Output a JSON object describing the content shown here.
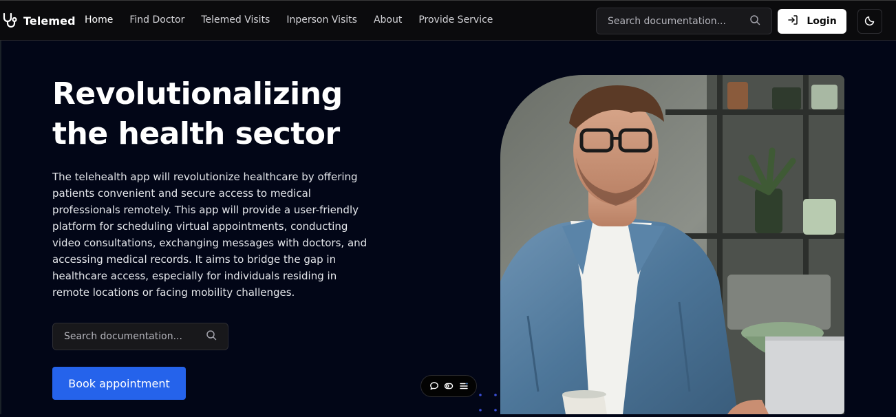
{
  "brand": {
    "name": "Telemed",
    "logo_icon": "stethoscope-icon"
  },
  "nav": {
    "items": [
      {
        "label": "Home",
        "active": true
      },
      {
        "label": "Find Doctor"
      },
      {
        "label": "Telemed Visits"
      },
      {
        "label": "Inperson Visits"
      },
      {
        "label": "About"
      },
      {
        "label": "Provide Service"
      }
    ]
  },
  "header": {
    "search": {
      "placeholder": "Search documentation...",
      "icon": "search-icon"
    },
    "login_label": "Login",
    "login_icon": "sign-in-icon",
    "theme_icon": "moon-icon"
  },
  "hero": {
    "title_line1": "Revolutionalizing",
    "title_line2": "the health sector",
    "description": "The telehealth app will revolutionize healthcare by offering patients convenient and secure access to medical professionals remotely. This app will provide a user-friendly platform for scheduling virtual appointments, conducting video consultations, exchanging messages with doctors, and accessing medical records. It aims to bridge the gap in healthcare access, especially for individuals residing in remote locations or facing mobility challenges.",
    "search": {
      "placeholder": "Search documentation...",
      "icon": "search-icon"
    },
    "cta_label": "Book appointment",
    "image_subject": "man-with-glasses-using-laptop"
  },
  "floating_toolbar": {
    "icons": [
      "chat-bubble-icon",
      "toggle-icon",
      "list-icon"
    ]
  },
  "colors": {
    "page_bg": "#020617",
    "topbar_bg": "#0b0b0d",
    "primary": "#2563eb",
    "login_bg": "#ffffff"
  }
}
